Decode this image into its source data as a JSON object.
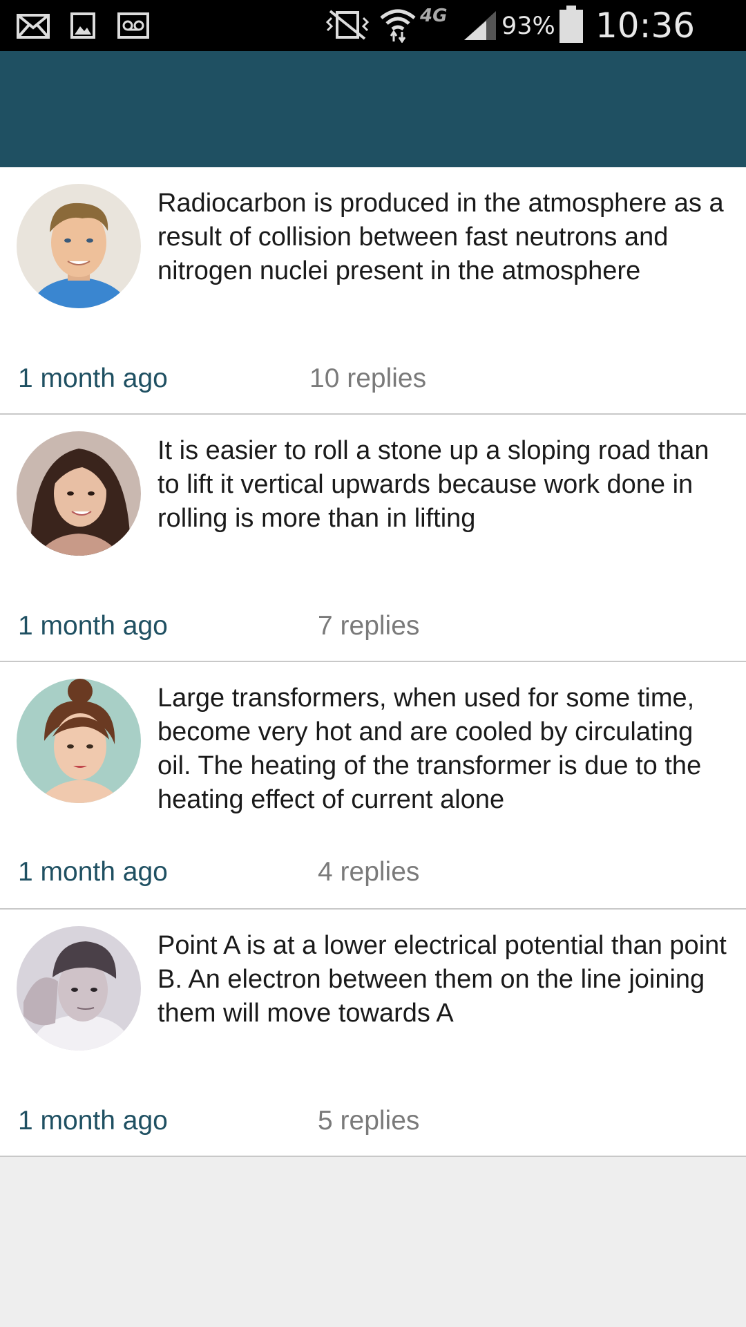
{
  "status_bar": {
    "battery_percent": "93%",
    "time": "10:36 PM",
    "network_label": "4G",
    "icons": [
      "mail-icon",
      "image-icon",
      "voicemail-icon",
      "vibrate-icon",
      "wifi-icon",
      "lte-icon",
      "signal-icon",
      "battery-icon"
    ]
  },
  "app_bar": {
    "color": "#1f5062"
  },
  "posts": [
    {
      "text": "Radiocarbon is produced in the atmosphere as a result of collision between fast neutrons and nitrogen nuclei present in the atmosphere",
      "time": "1 month ago",
      "replies": "10 replies",
      "avatar": "man-avatar"
    },
    {
      "text": "It is easier to roll a stone up a sloping road than to lift it vertical upwards because work done in rolling is more than in lifting",
      "time": "1 month ago",
      "replies": "7 replies",
      "avatar": "woman-avatar"
    },
    {
      "text": "Large transformers, when used for some time, become very hot and are cooled by circulating oil. The heating of the transformer is due to the heating effect of current alone",
      "time": "1 month ago",
      "replies": "4 replies",
      "avatar": "woman-bun-avatar"
    },
    {
      "text": "Point A is at a lower electrical potential than point B. An electron between them on the line joining them will move towards A",
      "time": "1 month ago",
      "replies": "5 replies",
      "avatar": "man-beanie-avatar"
    }
  ],
  "colors": {
    "accent": "#1f5062",
    "time_text": "#1f5062",
    "replies_text": "#7a7a7a",
    "background": "#eeeeee"
  }
}
